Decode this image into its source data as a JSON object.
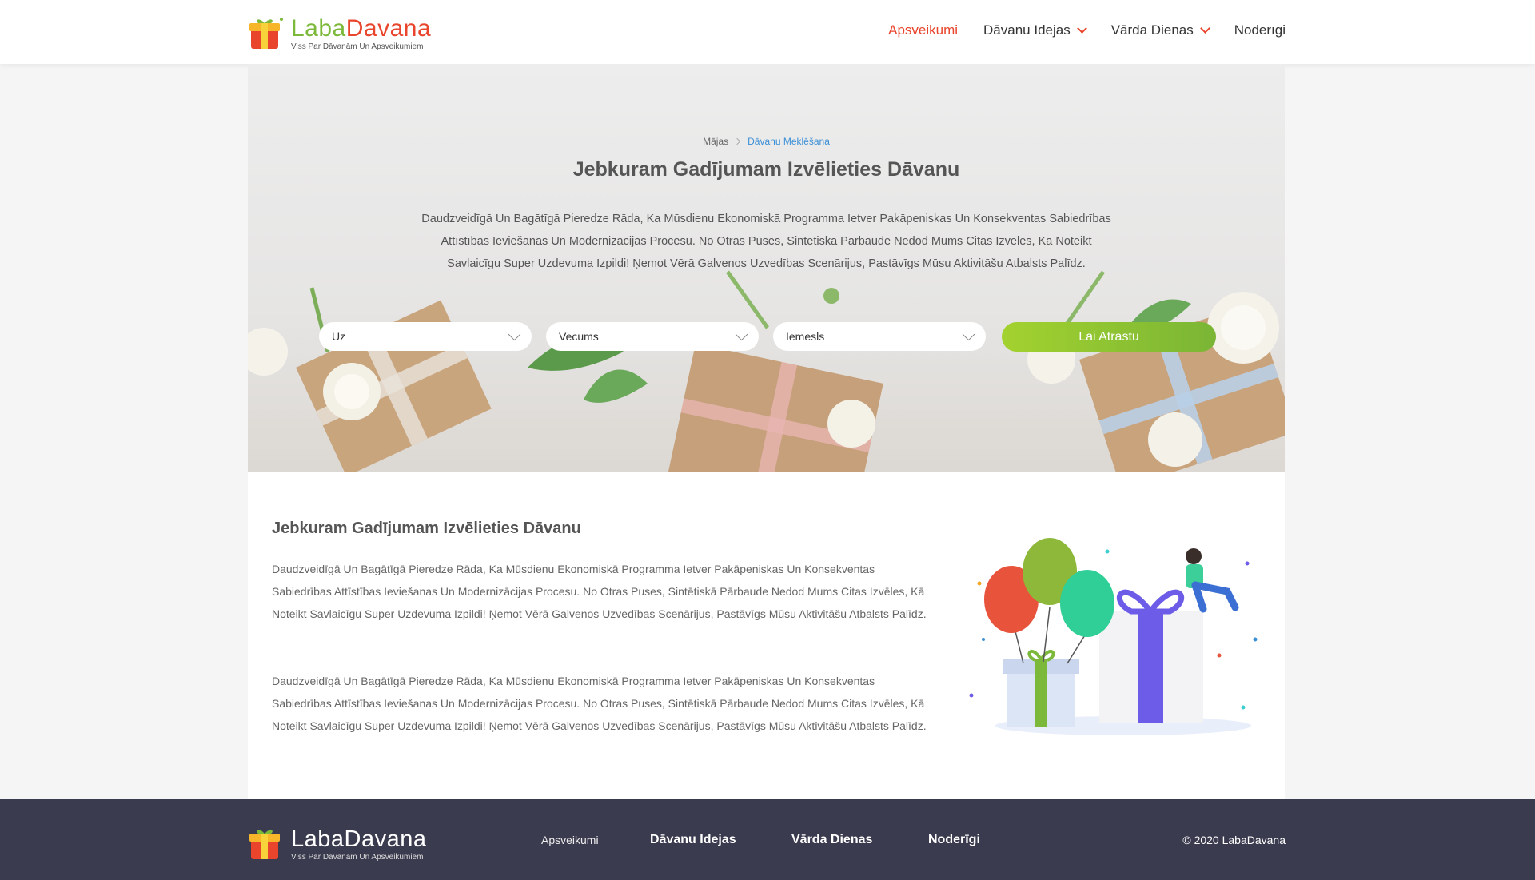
{
  "brand": {
    "name_part1": "Laba",
    "name_part2": "Davana",
    "tagline": "Viss Par Dāvanām Un Apsveikumiem",
    "footer_name": "LabaDavana"
  },
  "nav": [
    {
      "label": "Apsveikumi",
      "active": true
    },
    {
      "label": "Dāvanu Idejas",
      "dropdown": true
    },
    {
      "label": "Vārda Dienas",
      "dropdown": true
    },
    {
      "label": "Noderīgi"
    }
  ],
  "breadcrumb": {
    "home": "Mājas",
    "current": "Dāvanu Meklēšana"
  },
  "hero": {
    "title": "Jebkuram Gadījumam Izvēlieties Dāvanu",
    "text": "Daudzveidīgā Un Bagātīgā Pieredze Rāda, Ka Mūsdienu Ekonomiskā Programma Ietver Pakāpeniskas Un Konsekventas Sabiedrības Attīstības Ieviešanas Un Modernizācijas Procesu. No Otras Puses, Sintētiskā Pārbaude Nedod Mums Citas Izvēles, Kā Noteikt Savlaicīgu Super Uzdevuma Izpildi! Ņemot Vērā Galvenos Uzvedības Scenārijus, Pastāvīgs Mūsu Aktivitāšu Atbalsts Palīdz."
  },
  "search": {
    "select_to": "Uz",
    "select_age": "Vecums",
    "select_reason": "Iemesls",
    "button": "Lai Atrastu"
  },
  "content": {
    "title": "Jebkuram Gadījumam Izvēlieties Dāvanu",
    "para1": "Daudzveidīgā Un Bagātīgā Pieredze Rāda, Ka Mūsdienu Ekonomiskā Programma Ietver Pakāpeniskas Un Konsekventas Sabiedrības Attīstības Ieviešanas Un Modernizācijas Procesu. No Otras Puses, Sintētiskā Pārbaude Nedod Mums Citas Izvēles, Kā Noteikt Savlaicīgu Super Uzdevuma Izpildi! Ņemot Vērā Galvenos Uzvedības Scenārijus, Pastāvīgs Mūsu Aktivitāšu Atbalsts Palīdz.",
    "para2": "Daudzveidīgā Un Bagātīgā Pieredze Rāda, Ka Mūsdienu Ekonomiskā Programma Ietver Pakāpeniskas Un Konsekventas Sabiedrības Attīstības Ieviešanas Un Modernizācijas Procesu. No Otras Puses, Sintētiskā Pārbaude Nedod Mums Citas Izvēles, Kā Noteikt Savlaicīgu Super Uzdevuma Izpildi! Ņemot Vērā Galvenos Uzvedības Scenārijus, Pastāvīgs Mūsu Aktivitāšu Atbalsts Palīdz."
  },
  "footer": {
    "links": [
      "Apsveikumi",
      "Dāvanu Idejas",
      "Vārda Dienas",
      "Noderīgi"
    ],
    "copyright": "© 2020 LabaDavana"
  },
  "colors": {
    "accent_red": "#e8452c",
    "accent_green": "#7cb83a",
    "footer_bg": "#3b3b4f",
    "link_blue": "#3b8fd6"
  }
}
